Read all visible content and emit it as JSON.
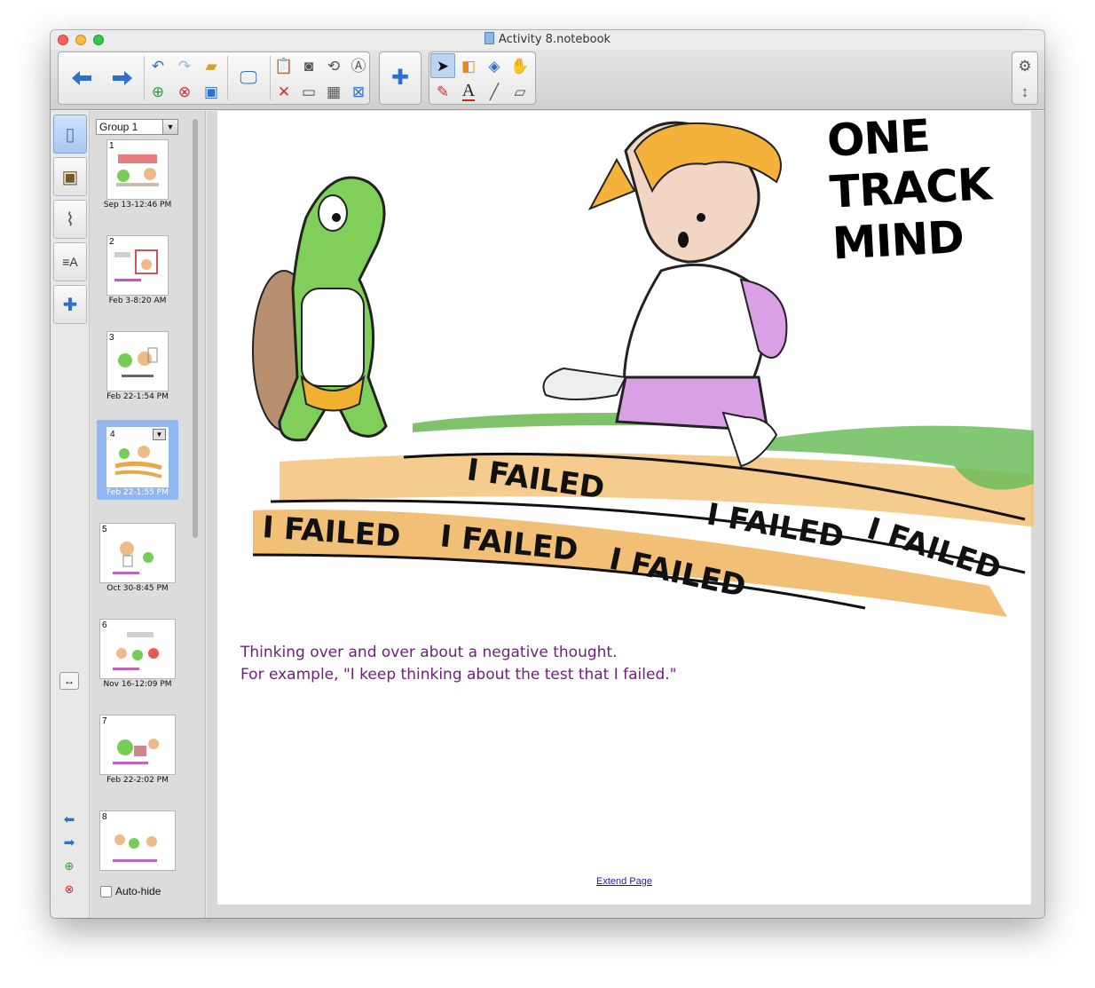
{
  "window": {
    "title": "Activity 8.notebook"
  },
  "toolbar": {
    "back_icon": "arrow-left-icon",
    "forward_icon": "arrow-right-icon",
    "colors": {
      "accent": "#2c70c9",
      "caption": "#6e1f7a"
    }
  },
  "sorter": {
    "group": "Group 1",
    "pages": [
      {
        "num": "1",
        "date": "Sep 13-12:46 PM"
      },
      {
        "num": "2",
        "date": "Feb 3-8:20 AM"
      },
      {
        "num": "3",
        "date": "Feb 22-1:54 PM"
      },
      {
        "num": "4",
        "date": "Feb 22-1:55 PM"
      },
      {
        "num": "5",
        "date": "Oct 30-8:45 PM"
      },
      {
        "num": "6",
        "date": "Nov 16-12:09 PM"
      },
      {
        "num": "7",
        "date": "Feb 22-2:02 PM"
      },
      {
        "num": "8",
        "date": ""
      }
    ],
    "autohide_label": "Auto-hide"
  },
  "page": {
    "cartoon_title_line1": "ONE",
    "cartoon_title_line2": "TRACK",
    "cartoon_title_line3": "MIND",
    "failed_text": "I FAILED",
    "caption_line1": "Thinking over and over about a negative thought.",
    "caption_line2": "For example, \"I keep thinking about the test that I failed.\"",
    "extend_link": "Extend Page"
  }
}
